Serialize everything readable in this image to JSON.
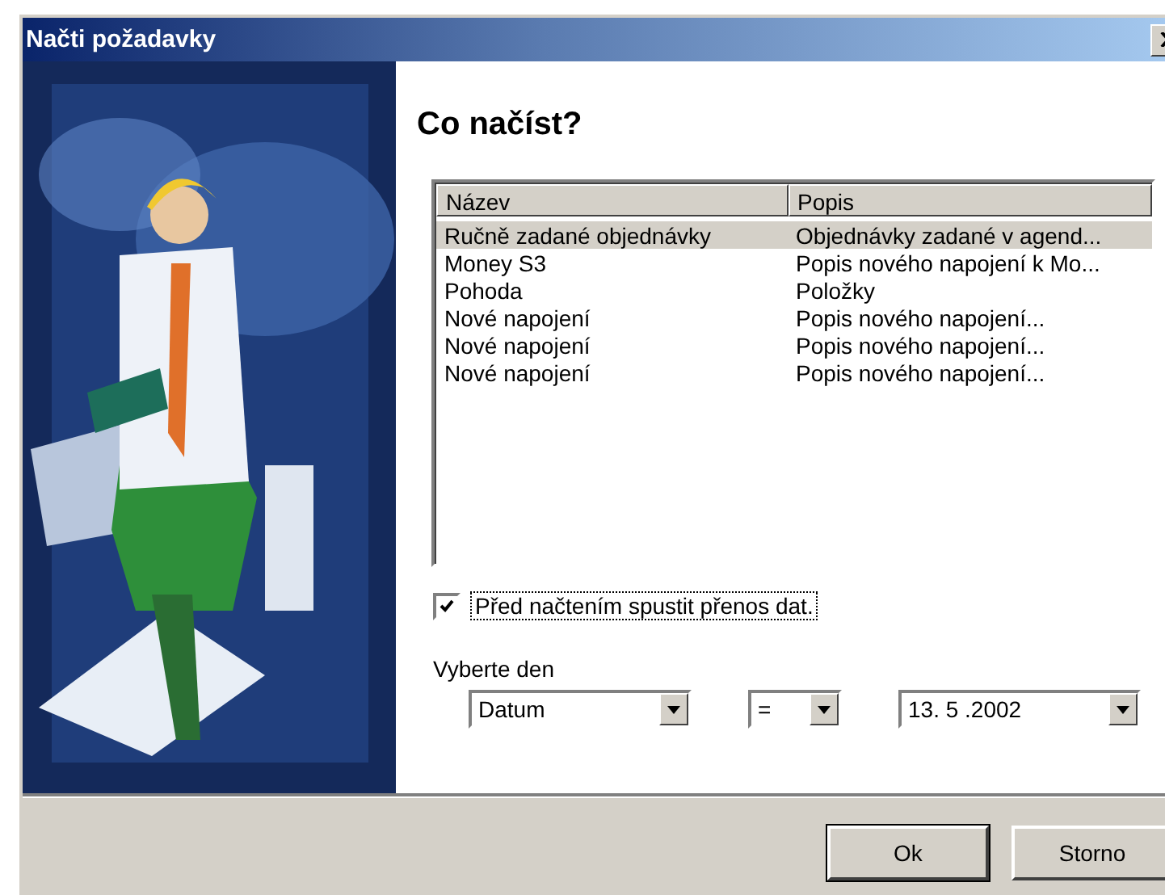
{
  "window": {
    "title": "Načti požadavky"
  },
  "heading": "Co načíst?",
  "list": {
    "columns": [
      "Název",
      "Popis"
    ],
    "rows": [
      {
        "name": "Ručně zadané objednávky",
        "description": "Objednávky zadané v agend...",
        "selected": true
      },
      {
        "name": "Money S3",
        "description": "Popis nového napojení k Mo...",
        "selected": false
      },
      {
        "name": "Pohoda",
        "description": "Položky",
        "selected": false
      },
      {
        "name": "Nové napojení",
        "description": "Popis nového napojení...",
        "selected": false
      },
      {
        "name": "Nové napojení",
        "description": "Popis nového napojení...",
        "selected": false
      },
      {
        "name": "Nové napojení",
        "description": "Popis nového napojení...",
        "selected": false
      }
    ]
  },
  "transfer_checkbox": {
    "label": "Před načtením spustit přenos dat.",
    "checked": true
  },
  "day_filter": {
    "label": "Vyberte den",
    "field": "Datum",
    "operator": "=",
    "date": "13. 5 .2002"
  },
  "buttons": [
    "Ok",
    "Storno"
  ]
}
